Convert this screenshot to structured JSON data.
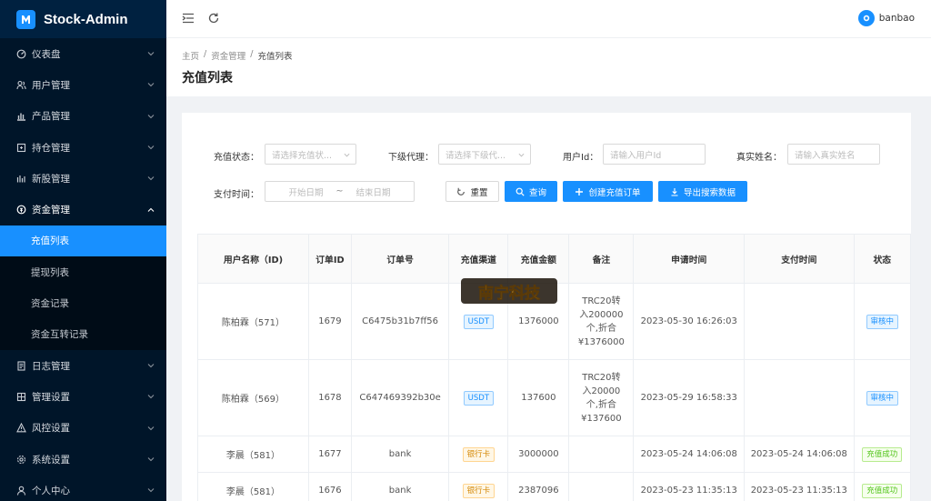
{
  "app": {
    "name": "Stock-Admin"
  },
  "sidebar": {
    "items": [
      {
        "label": "仪表盘",
        "icon": "dashboard-icon"
      },
      {
        "label": "用户管理",
        "icon": "users-icon"
      },
      {
        "label": "产品管理",
        "icon": "chart-bars-icon"
      },
      {
        "label": "持仓管理",
        "icon": "position-icon"
      },
      {
        "label": "新股管理",
        "icon": "ipo-icon"
      },
      {
        "label": "资金管理",
        "icon": "fund-icon",
        "open": true
      }
    ],
    "sub_items": [
      {
        "label": "充值列表",
        "active": true
      },
      {
        "label": "提现列表"
      },
      {
        "label": "资金记录"
      },
      {
        "label": "资金互转记录"
      }
    ],
    "items_after": [
      {
        "label": "日志管理",
        "icon": "log-icon"
      },
      {
        "label": "管理设置",
        "icon": "settings-grid-icon"
      },
      {
        "label": "风控设置",
        "icon": "warning-icon"
      },
      {
        "label": "系统设置",
        "icon": "gear-icon"
      },
      {
        "label": "个人中心",
        "icon": "user-icon"
      }
    ]
  },
  "header": {
    "username": "banbao"
  },
  "breadcrumb": {
    "home": "主页",
    "parent": "资金管理",
    "current": "充值列表",
    "sep": "/"
  },
  "page_title": "充值列表",
  "filters": {
    "status_label": "充值状态：",
    "status_placeholder": "请选择充值状...",
    "agent_label": "下级代理：",
    "agent_placeholder": "请选择下级代...",
    "userid_label": "用户Id：",
    "userid_placeholder": "请输入用户Id",
    "realname_label": "真实姓名：",
    "realname_placeholder": "请输入真实姓名",
    "paytime_label": "支付时间：",
    "start_placeholder": "开始日期",
    "range_sep": "~",
    "end_placeholder": "结束日期"
  },
  "buttons": {
    "reset": "重置",
    "search": "查询",
    "create": "创建充值订单",
    "export": "导出搜索数据"
  },
  "table": {
    "headers": [
      "用户名称（ID)",
      "订单ID",
      "订单号",
      "充值渠道",
      "充值金额",
      "备注",
      "申请时间",
      "支付时间",
      "状态"
    ],
    "rows": [
      {
        "user": "陈柏霖（571）",
        "order_id": "1679",
        "order_no": "C6475b31b7ff56",
        "channel": "USDT",
        "channel_type": "usdt",
        "amount": "1376000",
        "note_lines": [
          "TRC20转",
          "入200000",
          "个,折合",
          "¥1376000"
        ],
        "apply_time": "2023-05-30 16:26:03",
        "pay_time": "",
        "status": "审核中",
        "status_type": "pending"
      },
      {
        "user": "陈柏霖（569）",
        "order_id": "1678",
        "order_no": "C647469392b30e",
        "channel": "USDT",
        "channel_type": "usdt",
        "amount": "137600",
        "note_lines": [
          "TRC20转",
          "入20000",
          "个,折合",
          "¥137600"
        ],
        "apply_time": "2023-05-29 16:58:33",
        "pay_time": "",
        "status": "审核中",
        "status_type": "pending"
      },
      {
        "user": "李晨（581）",
        "order_id": "1677",
        "order_no": "bank",
        "channel": "银行卡",
        "channel_type": "bank",
        "amount": "3000000",
        "note_lines": [],
        "apply_time": "2023-05-24 14:06:08",
        "pay_time": "2023-05-24 14:06:08",
        "status": "充值成功",
        "status_type": "success"
      },
      {
        "user": "李晨（581）",
        "order_id": "1676",
        "order_no": "bank",
        "channel": "银行卡",
        "channel_type": "bank",
        "amount": "2387096",
        "note_lines": [],
        "apply_time": "2023-05-23 11:35:13",
        "pay_time": "2023-05-23 11:35:13",
        "status": "充值成功",
        "status_type": "success"
      }
    ]
  },
  "watermark": {
    "text": "南宁科技"
  },
  "colors": {
    "sidebar_bg": "#001529",
    "primary": "#1890ff",
    "success": "#52c41a",
    "warning": "#d48806"
  }
}
